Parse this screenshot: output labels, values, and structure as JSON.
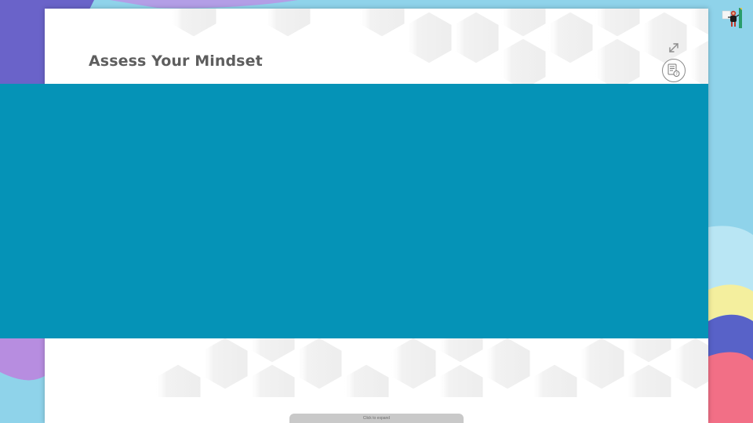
{
  "slide": {
    "title": "Assess Your Mindset"
  },
  "controls": {
    "expand_icon": "expand-diagonal-icon",
    "resource_icon": "document-question-icon",
    "expand_pill_label": "Click to expand"
  },
  "mascot": {
    "icon": "mascot-icon"
  },
  "colors": {
    "media_band": "#0593b7",
    "title_text": "#5e5e5e",
    "card_background": "#ffffff",
    "page_background": "#8fd3ea"
  }
}
